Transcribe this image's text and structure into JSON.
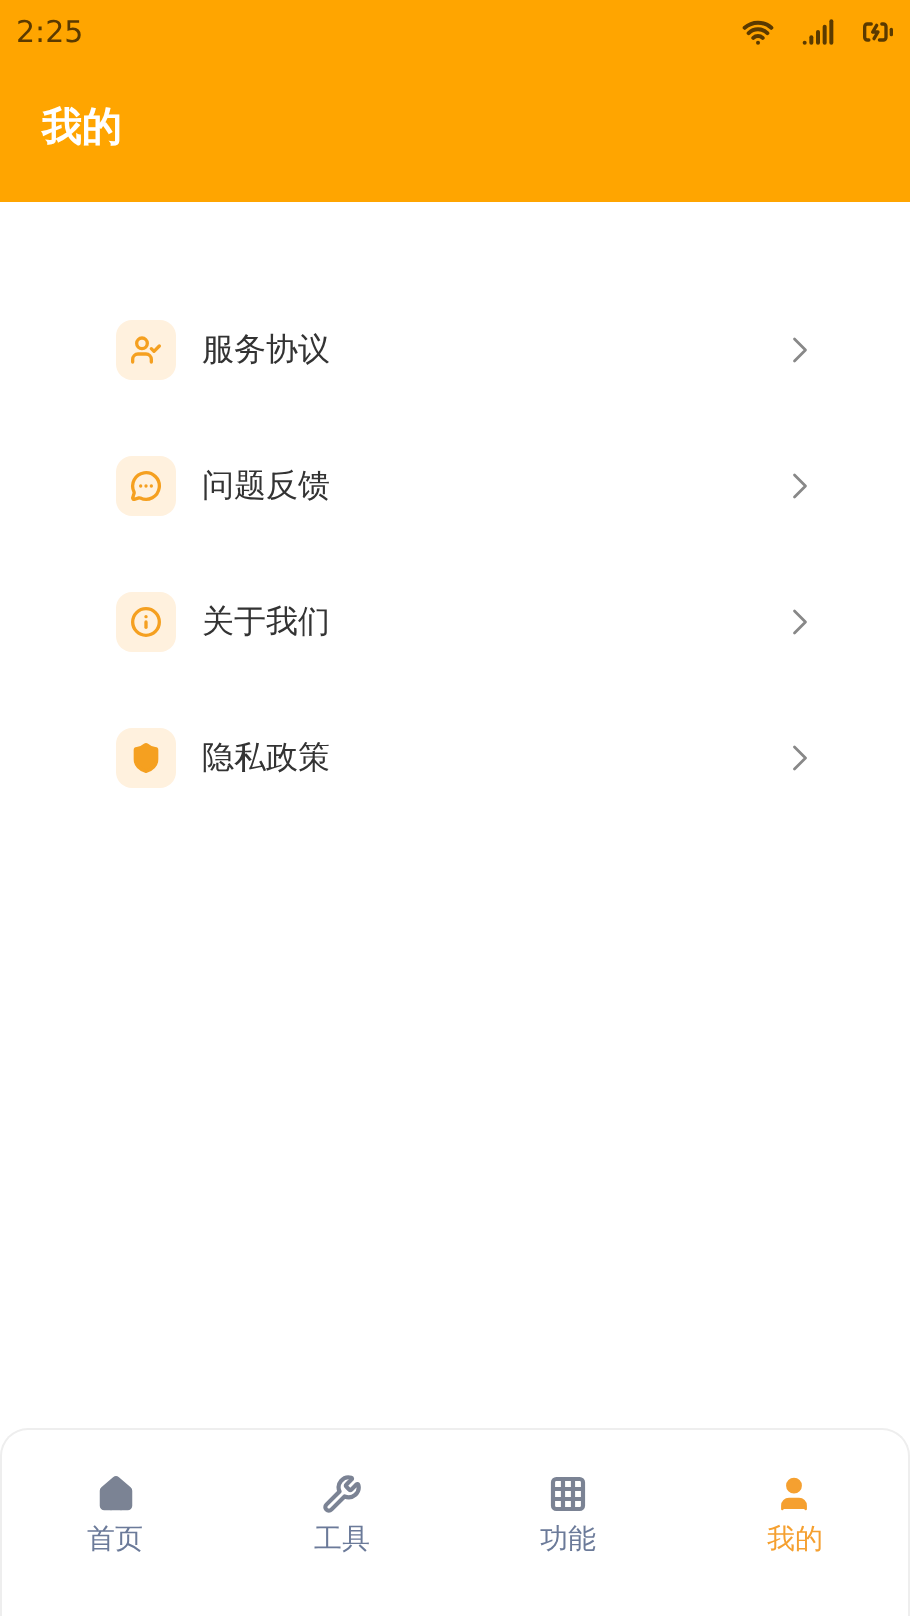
{
  "status_bar": {
    "time": "2:25"
  },
  "header": {
    "title": "我的"
  },
  "menu": [
    {
      "label": "服务协议",
      "kind": "agreement"
    },
    {
      "label": "问题反馈",
      "kind": "feedback"
    },
    {
      "label": "关于我们",
      "kind": "about"
    },
    {
      "label": "隐私政策",
      "kind": "privacy"
    }
  ],
  "tabs": [
    {
      "label": "首页",
      "kind": "home",
      "selected": false
    },
    {
      "label": "工具",
      "kind": "tools",
      "selected": false
    },
    {
      "label": "功能",
      "kind": "grid",
      "selected": false
    },
    {
      "label": "我的",
      "kind": "user",
      "selected": true
    }
  ]
}
